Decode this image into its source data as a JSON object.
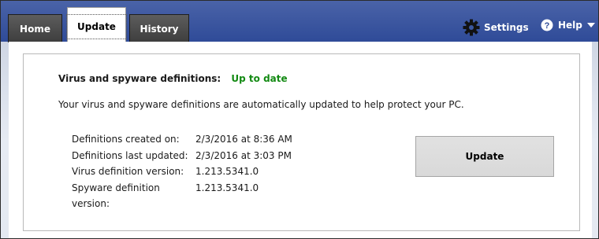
{
  "tabs": [
    {
      "label": "Home",
      "active": false
    },
    {
      "label": "Update",
      "active": true
    },
    {
      "label": "History",
      "active": false
    }
  ],
  "header": {
    "settings_label": "Settings",
    "help_label": "Help"
  },
  "icons": {
    "settings": "gear-icon",
    "help": "question-circle-icon",
    "help_menu": "chevron-down-icon"
  },
  "status": {
    "label": "Virus and spyware definitions:",
    "value": "Up to date",
    "value_color": "#138a13"
  },
  "description": "Your virus and spyware definitions are automatically updated to help protect your PC.",
  "details": [
    {
      "label": "Definitions created on:",
      "value": "2/3/2016 at 8:36 AM"
    },
    {
      "label": "Definitions last updated:",
      "value": "2/3/2016 at 3:03 PM"
    },
    {
      "label": "Virus definition version:",
      "value": "1.213.5341.0"
    },
    {
      "label": "Spyware definition version:",
      "value": "1.213.5341.0"
    }
  ],
  "update_button_label": "Update",
  "colors": {
    "header_blue": "#2f4b98",
    "tab_dark": "#3d3d3d"
  }
}
